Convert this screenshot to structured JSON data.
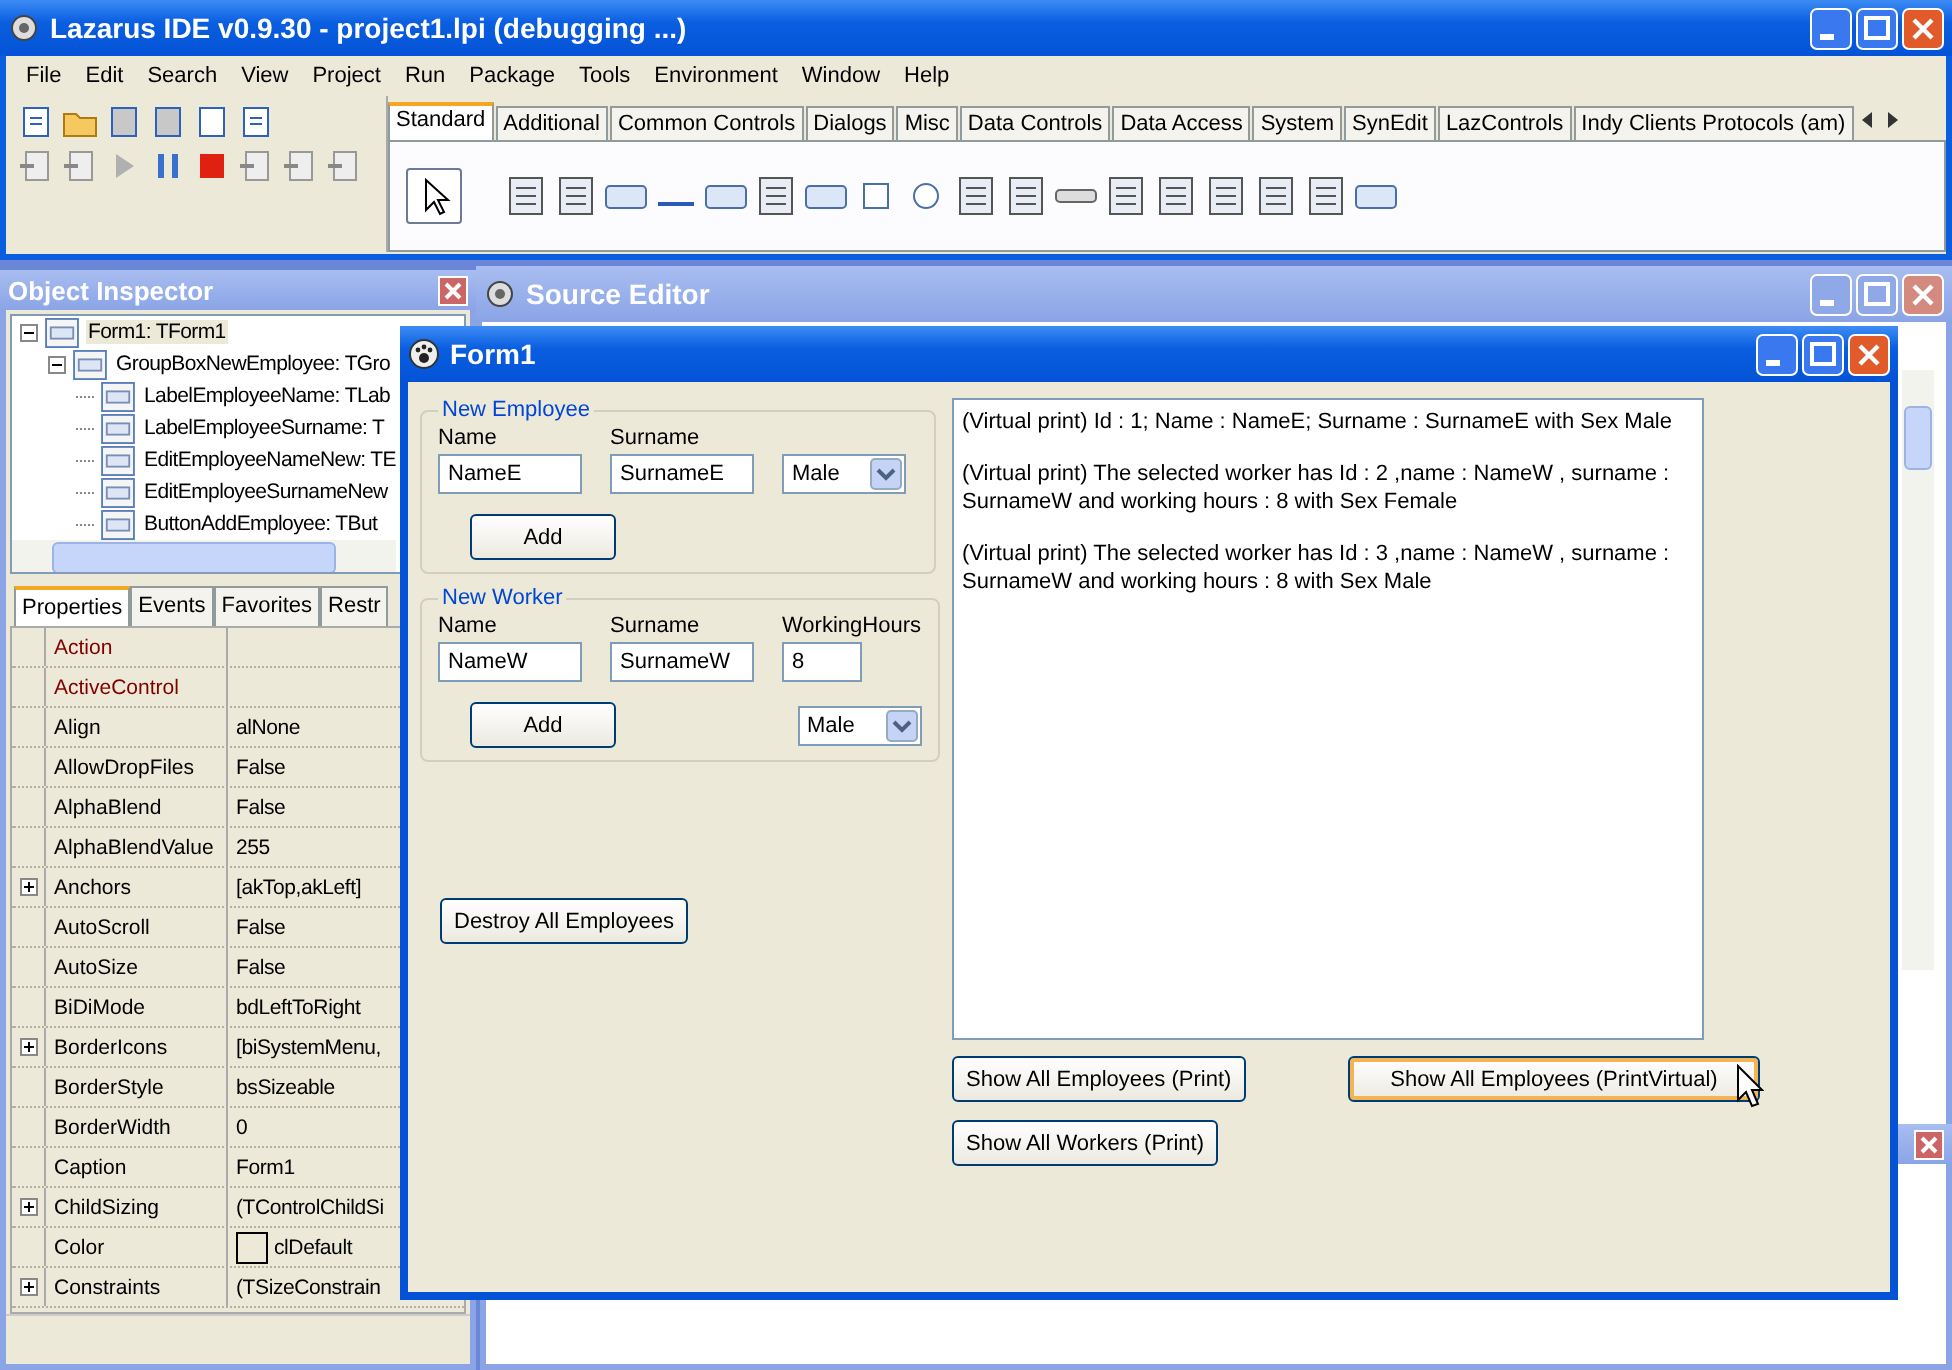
{
  "ide": {
    "title": "Lazarus IDE v0.9.30 - project1.lpi (debugging ...)",
    "menu": [
      "File",
      "Edit",
      "Search",
      "View",
      "Project",
      "Run",
      "Package",
      "Tools",
      "Environment",
      "Window",
      "Help"
    ],
    "palette_tabs": [
      {
        "label": "Standard",
        "selected": true
      },
      {
        "label": "Additional",
        "selected": false
      },
      {
        "label": "Common Controls",
        "selected": false
      },
      {
        "label": "Dialogs",
        "selected": false
      },
      {
        "label": "Misc",
        "selected": false
      },
      {
        "label": "Data Controls",
        "selected": false
      },
      {
        "label": "Data Access",
        "selected": false
      },
      {
        "label": "System",
        "selected": false
      },
      {
        "label": "SynEdit",
        "selected": false
      },
      {
        "label": "LazControls",
        "selected": false
      },
      {
        "label": "Indy Clients Protocols (am)",
        "selected": false
      }
    ]
  },
  "object_inspector": {
    "title": "Object Inspector",
    "tree": [
      {
        "label": "Form1: TForm1",
        "selected": true,
        "expanded": true,
        "children": [
          {
            "label": "GroupBoxNewEmployee: TGro",
            "selected": false,
            "expanded": true,
            "children": [
              {
                "label": "LabelEmployeeName: TLab",
                "selected": false
              },
              {
                "label": "LabelEmployeeSurname: T",
                "selected": false
              },
              {
                "label": "EditEmployeeNameNew: TE",
                "selected": false
              },
              {
                "label": "EditEmployeeSurnameNew",
                "selected": false
              },
              {
                "label": "ButtonAddEmployee: TBut",
                "selected": false
              }
            ]
          }
        ]
      }
    ],
    "tabs": [
      {
        "label": "Properties",
        "selected": true
      },
      {
        "label": "Events",
        "selected": false
      },
      {
        "label": "Favorites",
        "selected": false
      },
      {
        "label": "Restr",
        "selected": false
      }
    ],
    "properties": [
      {
        "kind": "reference",
        "name": "Action",
        "expandable": false
      },
      {
        "kind": "reference",
        "name": "ActiveControl",
        "expandable": false
      },
      {
        "kind": "plain",
        "name": "Align",
        "value": "alNone",
        "expandable": false
      },
      {
        "kind": "plain",
        "name": "AllowDropFiles",
        "value": "False",
        "expandable": false
      },
      {
        "kind": "plain",
        "name": "AlphaBlend",
        "value": "False",
        "expandable": false
      },
      {
        "kind": "plain",
        "name": "AlphaBlendValue",
        "value": "255",
        "expandable": false
      },
      {
        "kind": "plain",
        "name": "Anchors",
        "value": "[akTop,akLeft]",
        "expandable": true
      },
      {
        "kind": "plain",
        "name": "AutoScroll",
        "value": "False",
        "expandable": false
      },
      {
        "kind": "plain",
        "name": "AutoSize",
        "value": "False",
        "expandable": false
      },
      {
        "kind": "plain",
        "name": "BiDiMode",
        "value": "bdLeftToRight",
        "expandable": false
      },
      {
        "kind": "plain",
        "name": "BorderIcons",
        "value": "[biSystemMenu,",
        "expandable": true
      },
      {
        "kind": "plain",
        "name": "BorderStyle",
        "value": "bsSizeable",
        "expandable": false
      },
      {
        "kind": "plain",
        "name": "BorderWidth",
        "value": "0",
        "expandable": false
      },
      {
        "kind": "plain",
        "name": "Caption",
        "value": "Form1",
        "expandable": false
      },
      {
        "kind": "plain",
        "name": "ChildSizing",
        "value": "(TControlChildSi",
        "expandable": true
      },
      {
        "kind": "color",
        "name": "Color",
        "value": "clDefault",
        "expandable": false
      },
      {
        "kind": "plain",
        "name": "Constraints",
        "value": "(TSizeConstrain",
        "expandable": true
      }
    ]
  },
  "source_editor": {
    "title": "Source Editor"
  },
  "form": {
    "title": "Form1",
    "employee_group": {
      "title": "New Employee",
      "name_label": "Name",
      "name_value": "NameE",
      "surname_label": "Surname",
      "surname_value": "SurnameE",
      "sex": "Male",
      "add": "Add"
    },
    "worker_group": {
      "title": "New Worker",
      "name_label": "Name",
      "name_value": "NameW",
      "surname_label": "Surname",
      "surname_value": "SurnameW",
      "hours_label": "WorkingHours",
      "hours_value": "8",
      "sex": "Male",
      "add": "Add"
    },
    "destroy_button": "Destroy All Employees",
    "output": [
      "(Virtual print) Id : 1; Name : NameE; Surname : SurnameE with Sex Male",
      "(Virtual print) The selected worker has Id : 2 ,name : NameW , surname : SurnameW and working hours : 8 with Sex Female",
      "(Virtual print) The selected worker has Id : 3 ,name : NameW , surname : SurnameW and working hours : 8 with Sex Male"
    ],
    "buttons": [
      {
        "label": "Show All Employees (Print)",
        "focused": false
      },
      {
        "label": "Show All Employees (PrintVirtual)",
        "focused": true
      },
      {
        "label": "Show All Workers (Print)",
        "focused": false
      }
    ]
  }
}
